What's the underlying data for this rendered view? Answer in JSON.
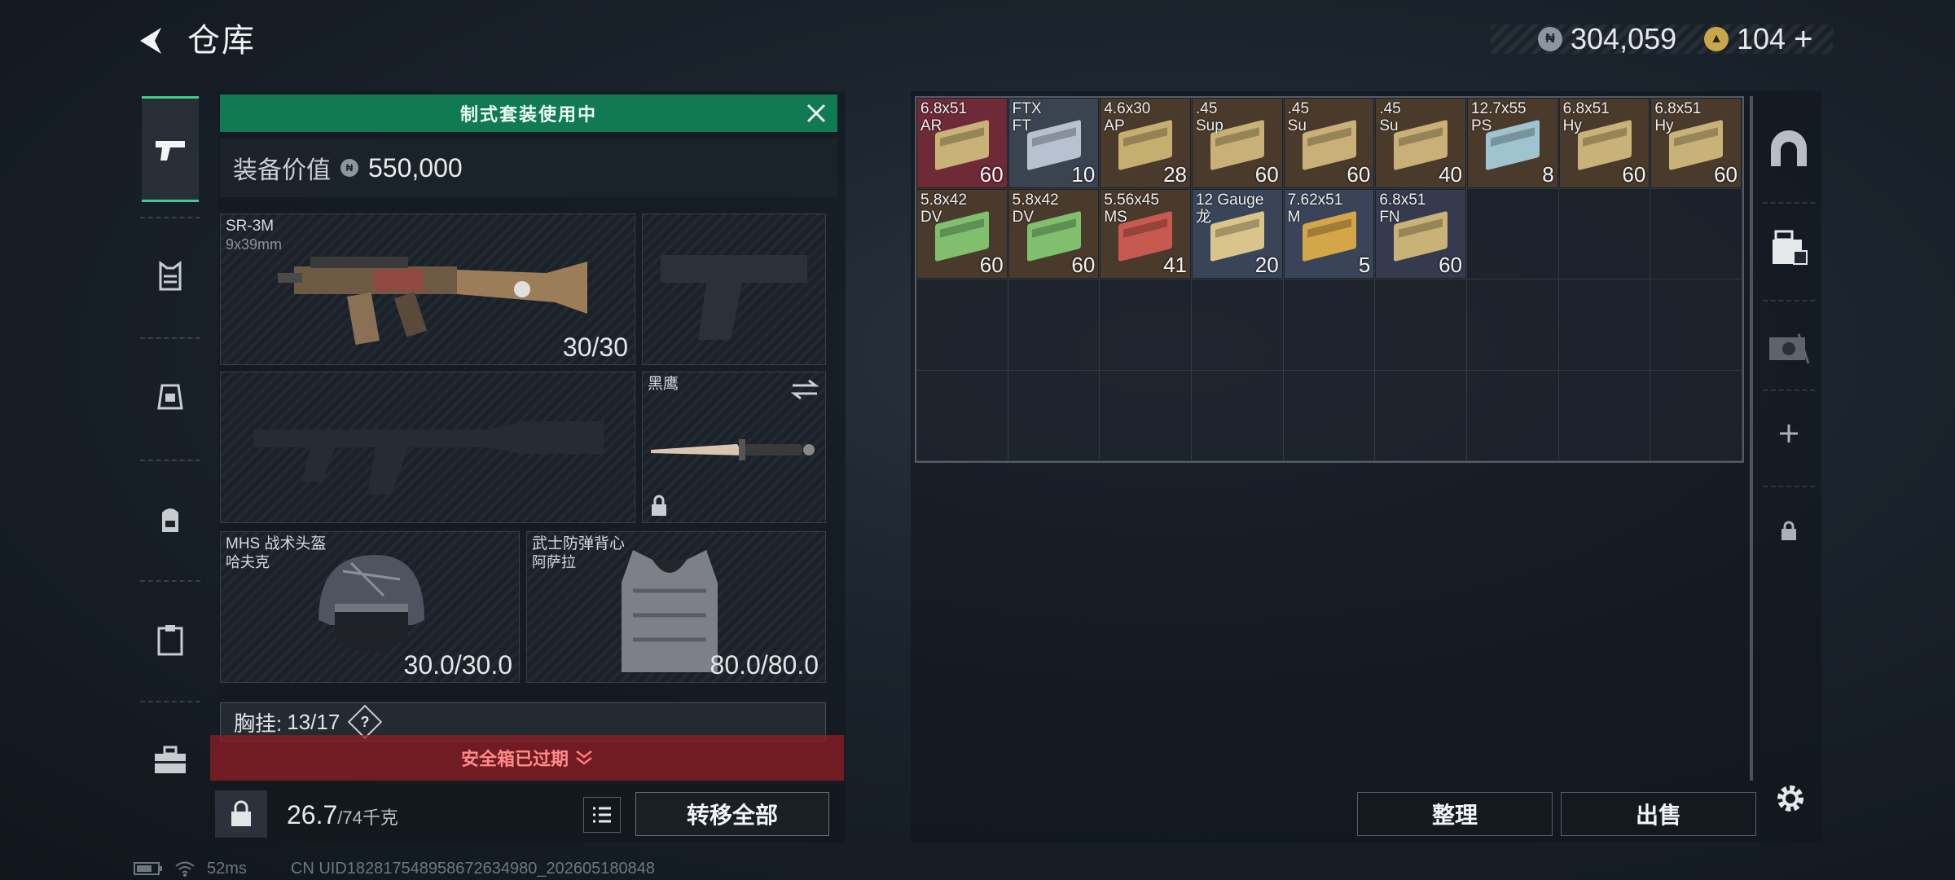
{
  "header": {
    "title": "仓库",
    "currency1": "304,059",
    "currency2": "104",
    "currency2_add": "+"
  },
  "loadout": {
    "kit_banner": "制式套装使用中",
    "value_label": "装备价值",
    "value": "550,000",
    "primary_weapon": {
      "name": "SR-3M",
      "sub": "9x39mm",
      "count": "30/30"
    },
    "melee": {
      "name": "黑鹰"
    },
    "helmet": {
      "name": "MHS 战术头盔",
      "sub": "哈夫克",
      "durability": "30.0/30.0"
    },
    "armor": {
      "name": "武士防弹背心",
      "sub": "阿萨拉",
      "durability": "80.0/80.0"
    },
    "chest_label": "胸挂:",
    "chest_value": "13/17",
    "chest_help": "?",
    "safe_box_banner": "安全箱已过期",
    "weight": "26.7",
    "weight_max": "/74千克",
    "transfer_all": "转移全部"
  },
  "stash": {
    "items": [
      {
        "label": "6.8x51\nAR",
        "count": "60",
        "bg": "#6e2a36",
        "box": "#c9b277"
      },
      {
        "label": "FTX\nFT",
        "count": "10",
        "bg": "#3a4350",
        "box": "#b7c1cf"
      },
      {
        "label": "4.6x30\nAP",
        "count": "28",
        "bg": "#4a3a2c",
        "box": "#c6ae70"
      },
      {
        "label": ".45\nSup",
        "count": "60",
        "bg": "#4a3a2c",
        "box": "#c8b077"
      },
      {
        "label": ".45\nSu",
        "count": "60",
        "bg": "#4a3a2c",
        "box": "#c8b077"
      },
      {
        "label": ".45\nSu",
        "count": "40",
        "bg": "#4a3a2c",
        "box": "#c8b077"
      },
      {
        "label": "12.7x55\nPS",
        "count": "8",
        "bg": "#4a3a2c",
        "box": "#9fc4cf"
      },
      {
        "label": "6.8x51\nHy",
        "count": "60",
        "bg": "#4a3a2c",
        "box": "#c9b277"
      },
      {
        "label": "6.8x51\nHy",
        "count": "60",
        "bg": "#4a3a2c",
        "box": "#c9b277"
      },
      {
        "label": "5.8x42\nDV",
        "count": "60",
        "bg": "#4a3a2c",
        "box": "#7fbf6e"
      },
      {
        "label": "5.8x42\nDV",
        "count": "60",
        "bg": "#4a3a2c",
        "box": "#7fbf6e"
      },
      {
        "label": "5.56x45\nMS",
        "count": "41",
        "bg": "#4a3a2c",
        "box": "#c75a4f"
      },
      {
        "label": "12 Gauge\n龙",
        "count": "20",
        "bg": "#3a4458",
        "box": "#d9c48a"
      },
      {
        "label": "7.62x51\nM",
        "count": "5",
        "bg": "#3a4458",
        "box": "#d4a64a"
      },
      {
        "label": "6.8x51\nFN",
        "count": "60",
        "bg": "#363a4e",
        "box": "#c9b277"
      }
    ],
    "sort_btn": "整理",
    "sell_btn": "出售"
  },
  "status": {
    "ping": "52ms",
    "uid": "CN UID1828175489586726349​80_202605180848"
  },
  "colors": {
    "accent_green": "#127a52",
    "danger_red": "#961c22"
  }
}
